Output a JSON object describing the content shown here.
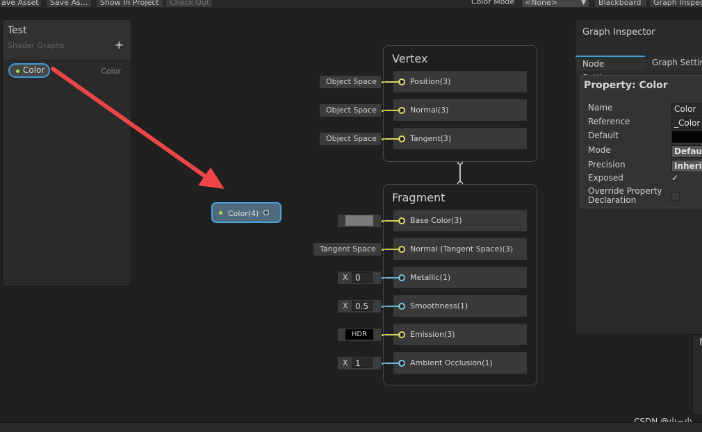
{
  "toolbar": {
    "save_asset": "ave Asset",
    "save_as": "Save As...",
    "show_in_project": "Show In Project",
    "check_out": "Check Out",
    "color_mode_label": "Color Mode",
    "color_mode_value": "<None>",
    "blackboard": "Blackboard",
    "graph_inspector": "Graph Inspec"
  },
  "blackboard": {
    "title": "Test",
    "subtitle": "Shader Graphs",
    "add": "+",
    "property": {
      "name": "Color",
      "type": "Color"
    }
  },
  "vertex": {
    "title": "Vertex",
    "slots": [
      {
        "label": "Position(3)",
        "input": "Object Space"
      },
      {
        "label": "Normal(3)",
        "input": "Object Space"
      },
      {
        "label": "Tangent(3)",
        "input": "Object Space"
      }
    ]
  },
  "fragment": {
    "title": "Fragment",
    "slots": [
      {
        "label": "Base Color(3)",
        "swatch": "#7b7b7b"
      },
      {
        "label": "Normal (Tangent Space)(3)",
        "input": "Tangent Space"
      },
      {
        "label": "Metallic(1)",
        "axis": "X",
        "value": "0"
      },
      {
        "label": "Smoothness(1)",
        "axis": "X",
        "value": "0.5"
      },
      {
        "label": "Emission(3)",
        "hdr": "HDR"
      },
      {
        "label": "Ambient Occlusion(1)",
        "axis": "X",
        "value": "1"
      }
    ]
  },
  "color_node": {
    "label": "Color(4)"
  },
  "inspector": {
    "title": "Graph Inspector",
    "tabs": [
      "Node Settings",
      "Graph Settin"
    ],
    "property_title": "Property: Color",
    "rows": {
      "name": {
        "label": "Name",
        "value": "Color"
      },
      "reference": {
        "label": "Reference",
        "value": "_Color"
      },
      "default": {
        "label": "Default"
      },
      "mode": {
        "label": "Mode",
        "value": "Default"
      },
      "precision": {
        "label": "Precision",
        "value": "Inherit"
      },
      "exposed": {
        "label": "Exposed",
        "value": "✓"
      },
      "override_1": "Override Property",
      "override_2": "Declaration"
    }
  },
  "watermark": "CSDN @小~小",
  "mini_panel_glyph": "N",
  "colors": {
    "accent": "#3e9fd8",
    "arrow": "#ee4646",
    "vector3_port": "#e0dc6a",
    "float_port": "#7cc6e0"
  }
}
